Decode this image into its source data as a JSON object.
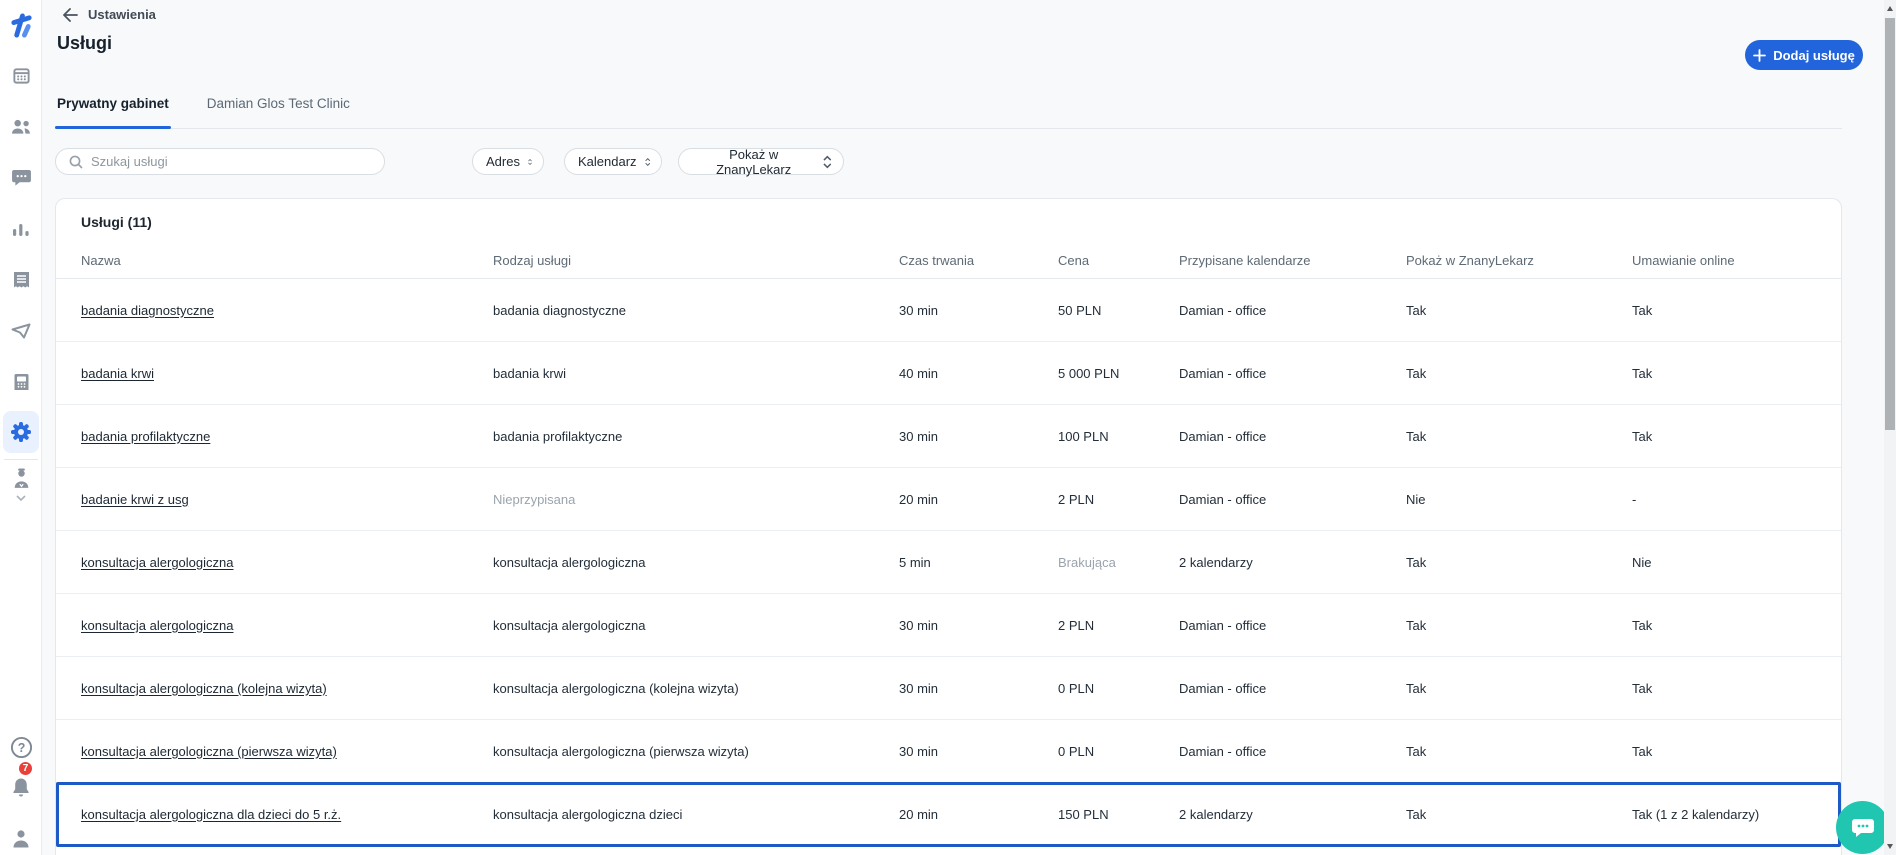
{
  "topbar": {
    "back_label": "Ustawienia"
  },
  "page": {
    "title": "Usługi"
  },
  "actions": {
    "add_service": "Dodaj usługę"
  },
  "tabs": [
    {
      "label": "Prywatny gabinet",
      "active": true
    },
    {
      "label": "Damian Glos Test Clinic",
      "active": false
    }
  ],
  "filters": {
    "search_placeholder": "Szukaj usługi",
    "dropdowns": [
      "Adres",
      "Kalendarz",
      "Pokaż w ZnanyLekarz"
    ]
  },
  "table": {
    "title": "Usługi (11)",
    "columns": [
      "Nazwa",
      "Rodzaj usługi",
      "Czas trwania",
      "Cena",
      "Przypisane kalendarze",
      "Pokaż w ZnanyLekarz",
      "Umawianie online"
    ],
    "rows": [
      {
        "name": "badania diagnostyczne",
        "type": "badania diagnostyczne",
        "duration": "30 min",
        "price": "50 PLN",
        "calendars": "Damian - office",
        "show_in_zl": "Tak",
        "online": "Tak",
        "highlighted": false
      },
      {
        "name": "badania krwi",
        "type": "badania krwi",
        "duration": "40 min",
        "price": "5 000 PLN",
        "calendars": "Damian - office",
        "show_in_zl": "Tak",
        "online": "Tak",
        "highlighted": false
      },
      {
        "name": "badania profilaktyczne",
        "type": "badania profilaktyczne",
        "duration": "30 min",
        "price": "100 PLN",
        "calendars": "Damian - office",
        "show_in_zl": "Tak",
        "online": "Tak",
        "highlighted": false
      },
      {
        "name": "badanie krwi z usg",
        "type": "Nieprzypisana",
        "type_muted": true,
        "duration": "20 min",
        "price": "2 PLN",
        "calendars": "Damian - office",
        "show_in_zl": "Nie",
        "online": "-",
        "highlighted": false
      },
      {
        "name": "konsultacja alergologiczna",
        "type": "konsultacja alergologiczna",
        "duration": "5 min",
        "price": "Brakująca",
        "price_muted": true,
        "calendars": "2 kalendarzy",
        "show_in_zl": "Tak",
        "online": "Nie",
        "highlighted": false
      },
      {
        "name": "konsultacja alergologiczna",
        "type": "konsultacja alergologiczna",
        "duration": "30 min",
        "price": "2 PLN",
        "calendars": "Damian - office",
        "show_in_zl": "Tak",
        "online": "Tak",
        "highlighted": false
      },
      {
        "name": "konsultacja alergologiczna (kolejna wizyta)",
        "type": "konsultacja alergologiczna (kolejna wizyta)",
        "duration": "30 min",
        "price": "0 PLN",
        "calendars": "Damian - office",
        "show_in_zl": "Tak",
        "online": "Tak",
        "highlighted": false
      },
      {
        "name": "konsultacja alergologiczna (pierwsza wizyta)",
        "type": "konsultacja alergologiczna (pierwsza wizyta)",
        "duration": "30 min",
        "price": "0 PLN",
        "calendars": "Damian - office",
        "show_in_zl": "Tak",
        "online": "Tak",
        "highlighted": false
      },
      {
        "name": "konsultacja alergologiczna dla dzieci do 5 r.ż.",
        "type": "konsultacja alergologiczna dzieci",
        "duration": "20 min",
        "price": "150 PLN",
        "calendars": "2 kalendarzy",
        "show_in_zl": "Tak",
        "online": "Tak (1 z 2 kalendarzy)",
        "highlighted": true
      }
    ]
  },
  "notifications": {
    "badge": "7"
  },
  "sidebar": {
    "icons": [
      "docplanner-logo",
      "calendar-icon",
      "patients-icon",
      "chat-icon",
      "stats-icon",
      "billing-icon",
      "campaigns-icon",
      "terminal-icon",
      "settings-icon",
      "doctor-icon",
      "help-icon",
      "notifications-bell-icon",
      "profile-icon"
    ]
  },
  "colors": {
    "accent": "#2264dc",
    "highlight_border": "#1d5ac6",
    "badge_red": "#e8403a",
    "chat_teal": "#21c6b1",
    "active_item_bg": "#e8f1fd"
  }
}
